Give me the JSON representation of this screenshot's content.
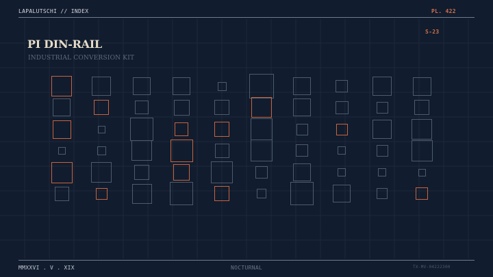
{
  "header": {
    "brand": "LAPALUTSCHI // INDEX",
    "plate": "PL. 422",
    "series": "S-23"
  },
  "title": "PI DIN-RAIL",
  "subtitle": "INDUSTRIAL CONVERSION KIT",
  "footer": {
    "date": "MMXXVI . V . XIX",
    "mode": "NOCTURNAL",
    "code": "TX-MV-04222300"
  },
  "colors": {
    "background": "#111c2e",
    "grid": "#1d2a3b",
    "muted_outline": "#4d5c6d",
    "accent_outline": "#c8643e",
    "title": "#e6dcc8"
  },
  "specimen_grid": {
    "columns": 10,
    "rows": 6,
    "accented_cells": [
      [
        0,
        0
      ],
      [
        1,
        1
      ],
      [
        5,
        1
      ],
      [
        0,
        2
      ],
      [
        3,
        2
      ],
      [
        4,
        2
      ],
      [
        7,
        2
      ],
      [
        3,
        3
      ],
      [
        0,
        4
      ],
      [
        3,
        4
      ],
      [
        1,
        5
      ],
      [
        4,
        5
      ],
      [
        9,
        5
      ]
    ]
  }
}
